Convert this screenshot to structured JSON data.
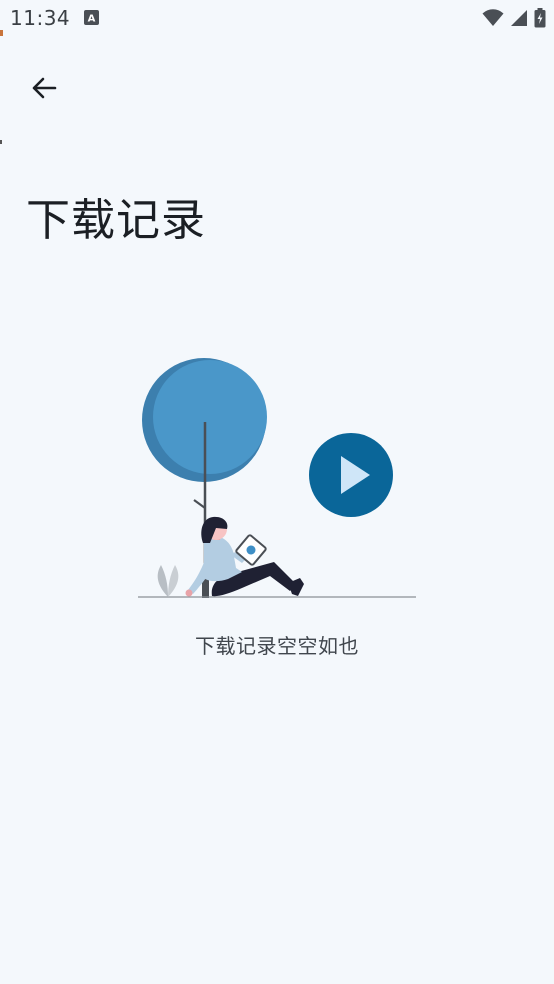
{
  "status_bar": {
    "time": "11:34",
    "notification_letter": "A",
    "icons": [
      "wifi-icon",
      "cellular-signal-icon",
      "battery-charging-icon"
    ]
  },
  "header": {
    "back_icon": "arrow-left-icon",
    "title": "下载记录"
  },
  "empty_state": {
    "illustration": "person-reading-under-tree-with-play-button",
    "message": "下载记录空空如也"
  },
  "colors": {
    "background": "#f4f8fc",
    "tree_light": "#4a97c9",
    "tree_dark": "#3c7fae",
    "play_circle": "#0a6699",
    "play_triangle": "#cfe6f8",
    "text_primary": "#1b1f24",
    "text_secondary": "#40464d"
  }
}
